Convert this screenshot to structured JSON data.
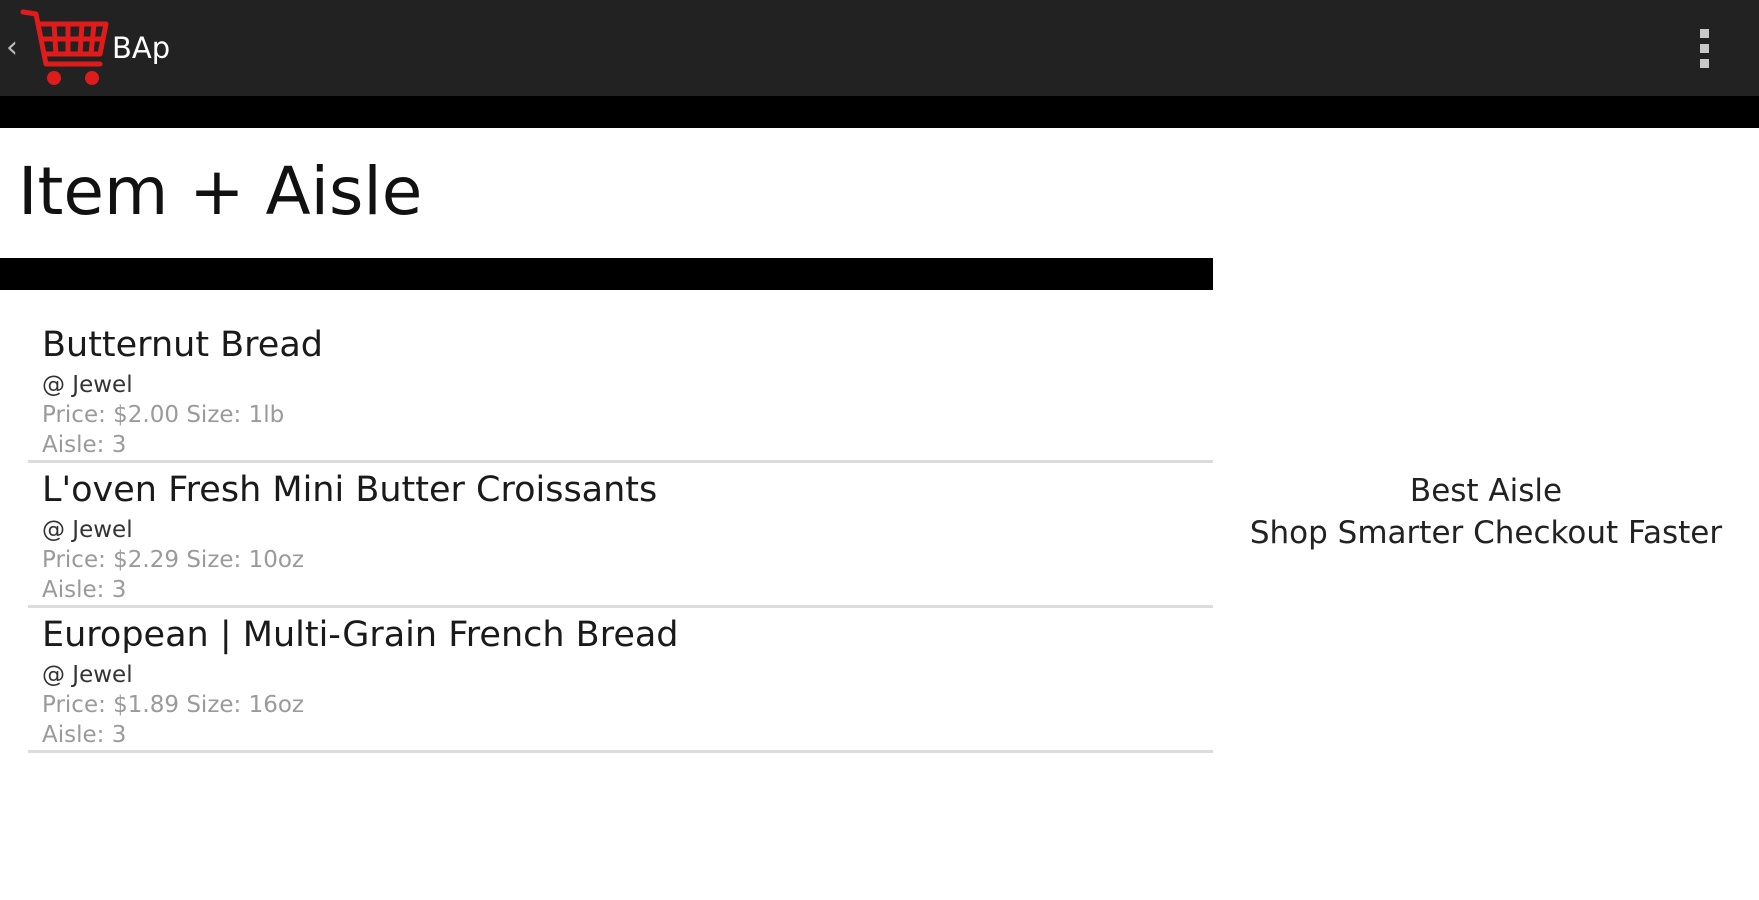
{
  "action_bar": {
    "app_title": "BAp",
    "icons": {
      "back": "chevron-left-icon",
      "logo": "shopping-cart-logo",
      "menu": "overflow-menu-icon"
    },
    "colors": {
      "bar": "#222222",
      "logo": "#e01b1b"
    }
  },
  "page": {
    "title": "Item + Aisle"
  },
  "items": [
    {
      "name": "Butternut Bread",
      "store": "@ Jewel",
      "price_size": "Price: $2.00 Size: 1lb",
      "aisle": "Aisle: 3"
    },
    {
      "name": "L'oven Fresh Mini Butter Croissants",
      "store": "@ Jewel",
      "price_size": "Price: $2.29 Size: 10oz",
      "aisle": "Aisle: 3"
    },
    {
      "name": "European | Multi-Grain French Bread",
      "store": "@ Jewel",
      "price_size": "Price: $1.89 Size: 16oz",
      "aisle": "Aisle: 3"
    }
  ],
  "side_panel": {
    "line1": "Best Aisle",
    "line2": "Shop Smarter Checkout Faster"
  }
}
